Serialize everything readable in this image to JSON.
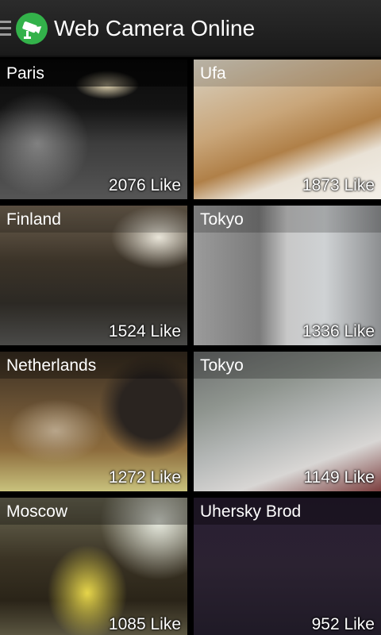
{
  "app": {
    "title": "Web Camera Online",
    "brand_color": "#33b24a",
    "menu_icon": "hamburger-icon",
    "logo_icon": "camera-icon"
  },
  "cameras": [
    {
      "name": "Paris",
      "likes": "2076 Like"
    },
    {
      "name": "Ufa",
      "likes": "1873 Like"
    },
    {
      "name": "Finland",
      "likes": "1524 Like"
    },
    {
      "name": "Tokyo",
      "likes": "1336 Like"
    },
    {
      "name": "Netherlands",
      "likes": "1272 Like"
    },
    {
      "name": "Tokyo",
      "likes": "1149 Like"
    },
    {
      "name": "Moscow",
      "likes": "1085 Like"
    },
    {
      "name": "Uhersky Brod",
      "likes": "952 Like"
    }
  ]
}
